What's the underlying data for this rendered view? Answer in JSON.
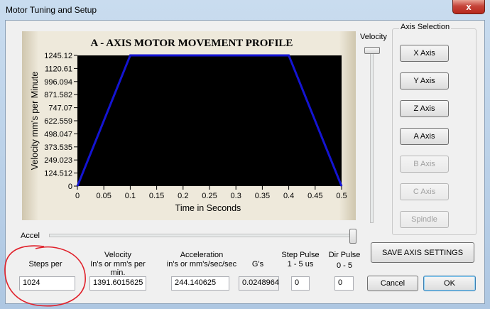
{
  "window": {
    "title": "Motor Tuning and Setup",
    "close_glyph": "x"
  },
  "chart_data": {
    "type": "line",
    "title": "A - AXIS MOTOR MOVEMENT PROFILE",
    "xlabel": "Time in Seconds",
    "ylabel": "Velocity mm's per Minute",
    "xlim": [
      0,
      0.5
    ],
    "ylim": [
      0,
      1245.12
    ],
    "xticks": [
      "0",
      "0.05",
      "0.1",
      "0.15",
      "0.2",
      "0.25",
      "0.3",
      "0.35",
      "0.4",
      "0.45",
      "0.5"
    ],
    "yticks": [
      "1245.12",
      "1120.61",
      "996.094",
      "871.582",
      "747.07",
      "622.559",
      "498.047",
      "373.535",
      "249.023",
      "124.512",
      "0"
    ],
    "series": [
      {
        "x": [
          0,
          0.1,
          0.4,
          0.5
        ],
        "y": [
          0,
          1245.12,
          1245.12,
          0
        ]
      }
    ],
    "colors": {
      "plot_bg": "#000000",
      "line": "#1414d2",
      "panel": "#e6dfcd"
    }
  },
  "velocity_slider": {
    "label": "Velocity",
    "value": 1.0
  },
  "accel_slider": {
    "label": "Accel",
    "value": 1.0
  },
  "axis_selection": {
    "title": "Axis Selection",
    "buttons": [
      {
        "label": "X Axis",
        "enabled": true
      },
      {
        "label": "Y Axis",
        "enabled": true
      },
      {
        "label": "Z Axis",
        "enabled": true
      },
      {
        "label": "A Axis",
        "enabled": true
      },
      {
        "label": "B Axis",
        "enabled": false
      },
      {
        "label": "C Axis",
        "enabled": false
      },
      {
        "label": "Spindle",
        "enabled": false
      }
    ]
  },
  "fields": {
    "steps_per": {
      "label": "Steps per",
      "value": "1024"
    },
    "velocity": {
      "label_line1": "Velocity",
      "label_line2": "In's or mm's per min.",
      "value": "1391.6015625"
    },
    "acceleration": {
      "label_line1": "Acceleration",
      "label_line2": "in's or mm's/sec/sec",
      "value": "244.140625"
    },
    "gs": {
      "label": "G's",
      "value": "0.0248964"
    },
    "step_pulse": {
      "label_line1": "Step Pulse",
      "label_line2": "1 - 5 us",
      "value": "0"
    },
    "dir_pulse": {
      "label_line1": "Dir Pulse",
      "label_line2": "0 - 5",
      "value": "0"
    }
  },
  "buttons": {
    "save": "SAVE AXIS SETTINGS",
    "cancel": "Cancel",
    "ok": "OK"
  },
  "annotation": {
    "color": "#e0202a"
  }
}
